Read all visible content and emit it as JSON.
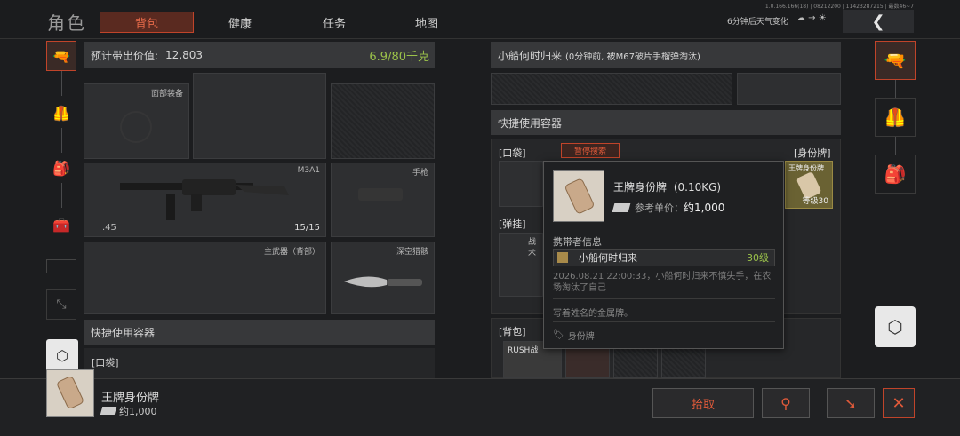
{
  "version": "1.0.166.166(18) | 08212200 | 11423287215 | 最数46~7",
  "title": "角色",
  "tabs": [
    "背包",
    "健康",
    "任务",
    "地图"
  ],
  "weather": "6分钟后天气变化",
  "left": {
    "carry_value_label": "预计带出价值:",
    "carry_value": "12,803",
    "weight": "6.9/80千克",
    "face_gear": "面部装备",
    "gun_name": "M3A1",
    "ammo_type": ".45",
    "ammo_count": "15/15",
    "pistol": "手枪",
    "primary_back": "主武器（背部）",
    "knife": "深空猎骸",
    "quick_container": "快捷使用容器",
    "pocket": "[口袋]"
  },
  "right": {
    "enemy_info": "小船何时归来",
    "enemy_detail": "(0分钟前, 被M67破片手榴弹淘汰)",
    "quick_container": "快捷使用容器",
    "pocket": "[口袋]",
    "pause_search": "暂停搜索",
    "id_tag_slot": "[身份牌]",
    "id_tag_item": "王牌身份牌",
    "id_tag_level": "等级30",
    "bomb": "[弹挂]",
    "tactic": "战术",
    "backpack": "[背包]",
    "rush": "RUSH战"
  },
  "tooltip": {
    "name": "王牌身份牌",
    "weight": "(0.10KG)",
    "price_label": "参考单价",
    "price": "约1,000",
    "carrier_header": "携带者信息",
    "carrier_name": "小船何时归来",
    "carrier_level": "30级",
    "log": "2026.08.21 22:00:33，小船何时归来不慎失手，在农场淘汰了自己",
    "desc": "写着姓名的金属牌。",
    "category": "身份牌"
  },
  "bottom": {
    "item_name": "王牌身份牌",
    "item_price": "约1,000",
    "pickup": "拾取"
  },
  "colors": {
    "accent": "#c0442a",
    "green": "#9bc24a",
    "gold": "#c9a83a"
  }
}
